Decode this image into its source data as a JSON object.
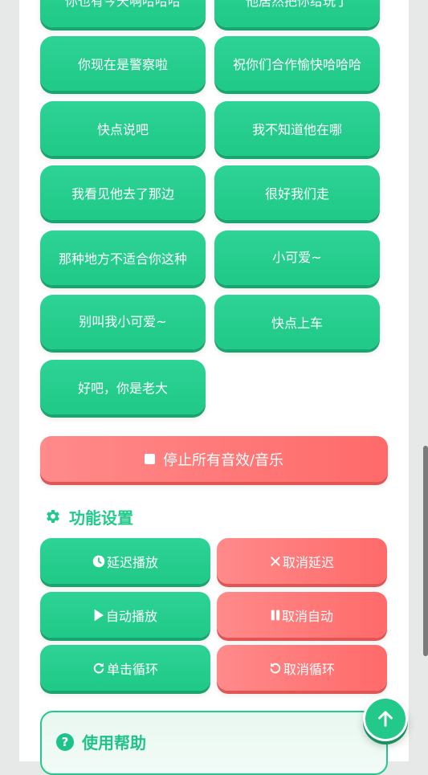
{
  "sound_buttons": [
    "你也有今天啊哈哈哈",
    "他居然把你给玩了",
    "你现在是警察啦",
    "祝你们合作愉快哈哈哈",
    "快点说吧",
    "我不知道他在哪",
    "我看见他去了那边",
    "很好我们走",
    "那种地方不适合你这种",
    "小可爱~",
    "别叫我小可爱~",
    "快点上车",
    "好吧，你是老大"
  ],
  "stop_all": {
    "label": "停止所有音效/音乐"
  },
  "settings": {
    "title": "功能设置",
    "delay_play": "延迟播放",
    "cancel_delay": "取消延迟",
    "auto_play": "自动播放",
    "cancel_auto": "取消自动",
    "single_loop": "单击循环",
    "cancel_loop": "取消循环"
  },
  "help": {
    "title": "使用帮助",
    "icon": "question-circle-icon"
  },
  "icons": {
    "settings": "gear-icon",
    "delay": "clock-icon",
    "cancel_delay": "close-icon",
    "auto": "play-icon",
    "cancel_auto": "pause-icon",
    "loop": "redo-icon",
    "cancel_loop": "undo-icon",
    "fab": "arrow-up-icon",
    "stop": "stop-icon"
  },
  "colors": {
    "accent_green": "#22c98a",
    "accent_red": "#ff6a6a",
    "background": "#e6e9e8"
  }
}
